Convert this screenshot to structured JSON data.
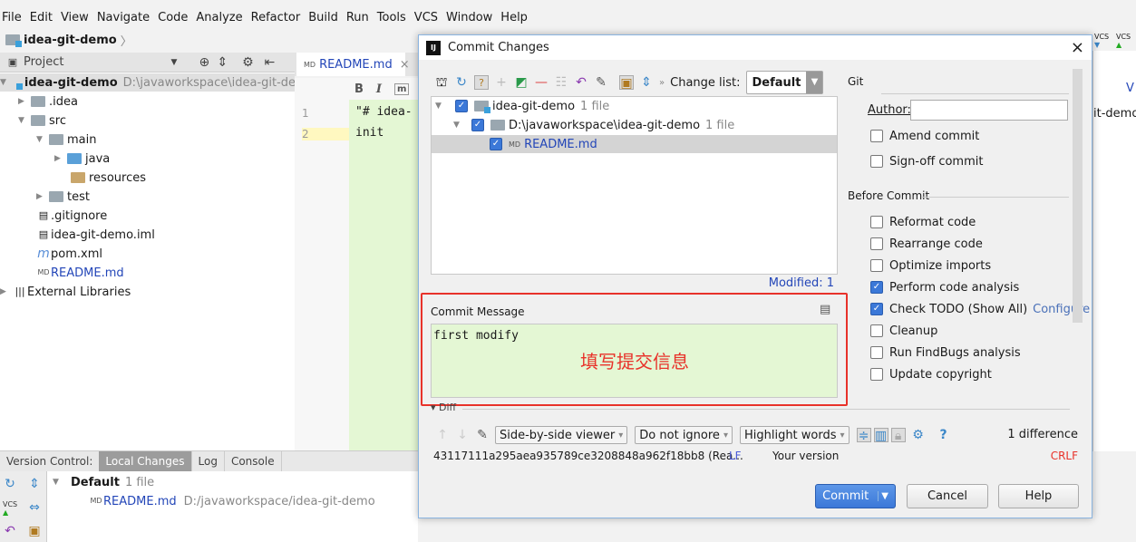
{
  "menu": [
    "File",
    "Edit",
    "View",
    "Navigate",
    "Code",
    "Analyze",
    "Refactor",
    "Build",
    "Run",
    "Tools",
    "VCS",
    "Window",
    "Help"
  ],
  "breadcrumb": "idea-git-demo",
  "project_panel": {
    "title": "Project",
    "root": {
      "name": "idea-git-demo",
      "path": "D:\\javaworkspace\\idea-git-demo"
    },
    "items": [
      ".idea",
      "src",
      "main",
      "java",
      "resources",
      "test",
      ".gitignore",
      "idea-git-demo.iml",
      "pom.xml",
      "README.md",
      "External Libraries"
    ]
  },
  "editor": {
    "tab": "README.md",
    "toolbar": [
      "B",
      "I",
      "m"
    ],
    "line_numbers": [
      "1",
      "2"
    ],
    "lines": [
      "\"# idea-",
      "init"
    ]
  },
  "bottom": {
    "tabs": [
      "Version Control:",
      "Local Changes",
      "Log",
      "Console"
    ],
    "group": "Default",
    "group_count": "1 file",
    "file": "README.md",
    "file_path": "D:/javaworkspace/idea-git-demo"
  },
  "right_edge": {
    "text1": "V",
    "text2": "it-demo",
    "vcs1": "VCS",
    "vcs2": "VCS"
  },
  "dialog": {
    "title": "Commit Changes",
    "changelist_label": "Change list:",
    "changelist_value": "Default",
    "tree": [
      {
        "name": "idea-git-demo",
        "count": "1 file"
      },
      {
        "name": "D:\\javaworkspace\\idea-git-demo",
        "count": "1 file"
      },
      {
        "name": "README.md"
      }
    ],
    "modified": "Modified: 1",
    "commit_message_label": "Commit Message",
    "commit_message": "first modify",
    "annotation": "填写提交信息",
    "git_label": "Git",
    "author_label": "Author:",
    "author_value": "",
    "git_options": [
      {
        "label": "Amend commit",
        "checked": false
      },
      {
        "label": "Sign-off commit",
        "checked": false
      }
    ],
    "before_commit_label": "Before Commit",
    "before_commit": [
      {
        "label": "Reformat code",
        "checked": false
      },
      {
        "label": "Rearrange code",
        "checked": false
      },
      {
        "label": "Optimize imports",
        "checked": false
      },
      {
        "label": "Perform code analysis",
        "checked": true
      },
      {
        "label": "Check TODO (Show All)",
        "checked": true
      },
      {
        "label": "Cleanup",
        "checked": false
      },
      {
        "label": "Run FindBugs analysis",
        "checked": false
      },
      {
        "label": "Update copyright",
        "checked": false
      }
    ],
    "configure": "Configure",
    "diff_label": "Diff",
    "viewer": "Side-by-side viewer",
    "ignore": "Do not ignore",
    "highlight": "Highlight words",
    "differences": "1 difference",
    "revision": "43117111a295aea935789ce3208848a962f18bb8 (Rea...",
    "left_eol": "LF",
    "your_version": "Your version",
    "right_eol": "CRLF",
    "buttons": {
      "commit": "Commit",
      "cancel": "Cancel",
      "help": "Help"
    },
    "colors": {
      "accent": "#3b78d8",
      "annotation": "#e8322a",
      "message_bg": "#e4f7d4"
    }
  }
}
